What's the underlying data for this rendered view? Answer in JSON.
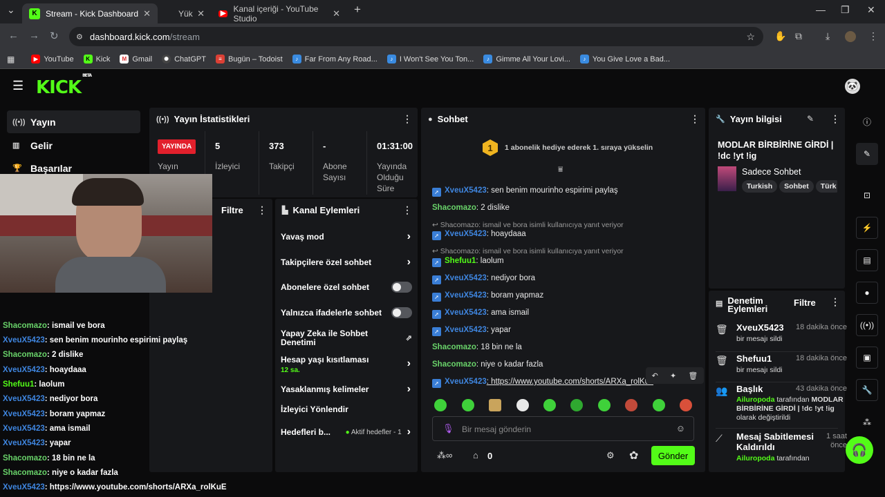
{
  "browser": {
    "tabs": [
      {
        "label": "Stream - Kick Dashboard",
        "active": true
      },
      {
        "label": "Yük"
      },
      {
        "label": "Kanal içeriği - YouTube Studio"
      }
    ],
    "url_host": "dashboard.kick.com",
    "url_path": "/stream",
    "bookmarks": [
      "YouTube",
      "Kick",
      "Gmail",
      "ChatGPT",
      "Bugün – Todoist",
      "Far From Any Road...",
      "I Won't See You Ton...",
      "Gimme All Your Lovi...",
      "You Give Love a Bad..."
    ]
  },
  "logo": {
    "text": "KICK",
    "beta": "BETA"
  },
  "nav": [
    "Yayın",
    "Gelir",
    "Başarılar"
  ],
  "stats": {
    "title": "Yayın İstatistikleri",
    "live_badge": "YAYINDA",
    "stream_label": "Yayın",
    "items": [
      {
        "value": "5",
        "label": "İzleyici"
      },
      {
        "value": "373",
        "label": "Takipçi"
      },
      {
        "value": "-",
        "label": "Abone Sayısı"
      },
      {
        "value": "01:31:00",
        "label": "Yayında Olduğu Süre"
      }
    ]
  },
  "filter_panel": {
    "title": "Filtre"
  },
  "channel_actions": {
    "title": "Kanal Eylemleri",
    "items": [
      {
        "label": "Yavaş mod"
      },
      {
        "label": "Takipçilere özel sohbet"
      },
      {
        "label": "Abonelere özel sohbet"
      },
      {
        "label": "Yalnızca ifadelerle sohbet"
      },
      {
        "label": "Yapay Zeka ile Sohbet Denetimi"
      },
      {
        "label": "Hesap yaşı kısıtlaması",
        "sub": "12 sa."
      },
      {
        "label": "Yasaklanmış kelimeler"
      },
      {
        "label": "İzleyici Yönlendir"
      },
      {
        "label": "Hedefleri b...",
        "sub": "Aktif hedefler - 1"
      }
    ]
  },
  "chat": {
    "title": "Sohbet",
    "gift_number": "1",
    "gift_text": "1 abonelik hediye ederek 1. sıraya yükselin",
    "messages": [
      {
        "user": "XveuX5423",
        "text": ": sen benim mourinho espirimi paylaş"
      },
      {
        "user": "Shacomazo",
        "text": ": 2 dislike"
      },
      {
        "reply": "Shacomazo: ismail ve bora isimli kullanıcıya yanıt veriyor"
      },
      {
        "user": "XveuX5423",
        "text": ": hoaydaaa"
      },
      {
        "reply": "Shacomazo: ismail ve bora isimli kullanıcıya yanıt veriyor"
      },
      {
        "user": "Shefuu1",
        "text": ": laolum"
      },
      {
        "user": "XveuX5423",
        "text": ": nediyor bora"
      },
      {
        "user": "XveuX5423",
        "text": ": boram yapmaz"
      },
      {
        "user": "XveuX5423",
        "text": ": ama ismail"
      },
      {
        "user": "XveuX5423",
        "text": ": yapar"
      },
      {
        "user": "Shacomazo",
        "text": ": 18 bin ne la"
      },
      {
        "user": "Shacomazo",
        "text": ": niye o kadar fazla"
      },
      {
        "user": "XveuX5423",
        "text": ": https://www.youtube.com/shorts/ARXa_rolKuE"
      }
    ],
    "input_placeholder": "Bir mesaj gönderin",
    "points": "0",
    "send_label": "Gönder"
  },
  "overlay_chat": [
    {
      "user": "Shacomazo",
      "text": ": ismail ve bora"
    },
    {
      "user": "XveuX5423",
      "text": ": sen benim mourinho espirimi paylaş"
    },
    {
      "user": "Shacomazo",
      "text": ": 2 dislike"
    },
    {
      "user": "XveuX5423",
      "text": ": hoaydaaa"
    },
    {
      "user": "Shefuu1",
      "text": ": laolum"
    },
    {
      "user": "XveuX5423",
      "text": ": nediyor bora"
    },
    {
      "user": "XveuX5423",
      "text": ": boram yapmaz"
    },
    {
      "user": "XveuX5423",
      "text": ": ama ismail"
    },
    {
      "user": "XveuX5423",
      "text": ": yapar"
    },
    {
      "user": "Shacomazo",
      "text": ": 18 bin ne la"
    },
    {
      "user": "Shacomazo",
      "text": ": niye o kadar fazla"
    },
    {
      "user": "XveuX5423",
      "text": ": https://www.youtube.com/shorts/ARXa_rolKuE"
    }
  ],
  "stream_info": {
    "title": "Yayın bilgisi",
    "stream_title": "MODLAR BİRBİRİNE GİRDİ | !dc !yt !ig",
    "category": "Sadece Sohbet",
    "tags": [
      "Turkish",
      "Sohbet",
      "Türk"
    ]
  },
  "mod_actions": {
    "title": "Denetim Eylemleri",
    "filter": "Filtre",
    "items": [
      {
        "who": "XveuX5423",
        "time": "18 dakika önce",
        "desc": "bir mesajı sildi"
      },
      {
        "who": "Shefuu1",
        "time": "18 dakika önce",
        "desc": "bir mesajı sildi"
      },
      {
        "who": "Başlık",
        "time": "43 dakika önce",
        "by": "Ailuropoda",
        "desc_a": " tarafından ",
        "desc_b": "MODLAR BİRBİRİNE GİRDİ | !dc !yt !ig",
        "desc_c": " olarak değiştirildi"
      },
      {
        "who": "Mesaj Sabitlemesi Kaldırıldı",
        "time": "1 saat önce",
        "by": "Ailuropoda",
        "desc_a": " tarafından"
      }
    ]
  },
  "colors": {
    "brand": "#53fc18",
    "live": "#e2202c",
    "user_blue": "#3f86e0"
  }
}
